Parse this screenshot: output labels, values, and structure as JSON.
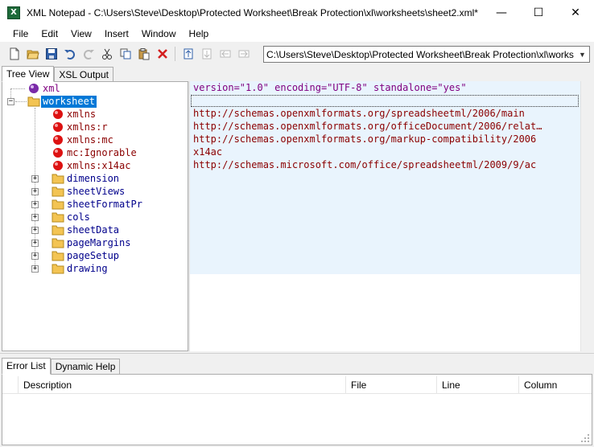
{
  "window": {
    "title": "XML Notepad - C:\\Users\\Steve\\Desktop\\Protected Worksheet\\Break Protection\\xl\\worksheets\\sheet2.xml*",
    "icon_letter": "X",
    "minimize": "—",
    "maximize": "☐",
    "close": "✕"
  },
  "menu": {
    "items": [
      "File",
      "Edit",
      "View",
      "Insert",
      "Window",
      "Help"
    ]
  },
  "toolbar": {
    "path_value": "C:\\Users\\Steve\\Desktop\\Protected Worksheet\\Break Protection\\xl\\works",
    "combo_arrow": "▼"
  },
  "top_tabs": [
    "Tree View",
    "XSL Output"
  ],
  "tree": {
    "rows": [
      {
        "label": "xml",
        "kind": "pi"
      },
      {
        "label": "worksheet",
        "kind": "element",
        "selected": true,
        "expander": "−"
      },
      {
        "label": "xmlns",
        "kind": "attr"
      },
      {
        "label": "xmlns:r",
        "kind": "attr"
      },
      {
        "label": "xmlns:mc",
        "kind": "attr"
      },
      {
        "label": "mc:Ignorable",
        "kind": "attr"
      },
      {
        "label": "xmlns:x14ac",
        "kind": "attr"
      },
      {
        "label": "dimension",
        "kind": "element",
        "expander": "+"
      },
      {
        "label": "sheetViews",
        "kind": "element",
        "expander": "+"
      },
      {
        "label": "sheetFormatPr",
        "kind": "element",
        "expander": "+"
      },
      {
        "label": "cols",
        "kind": "element",
        "expander": "+"
      },
      {
        "label": "sheetData",
        "kind": "element",
        "expander": "+"
      },
      {
        "label": "pageMargins",
        "kind": "element",
        "expander": "+"
      },
      {
        "label": "pageSetup",
        "kind": "element",
        "expander": "+"
      },
      {
        "label": "drawing",
        "kind": "element",
        "expander": "+"
      }
    ]
  },
  "values": {
    "rows": [
      "version=\"1.0\" encoding=\"UTF-8\" standalone=\"yes\"",
      "",
      "http://schemas.openxmlformats.org/spreadsheetml/2006/main",
      "http://schemas.openxmlformats.org/officeDocument/2006/relat…",
      "http://schemas.openxmlformats.org/markup-compatibility/2006",
      "x14ac",
      "http://schemas.microsoft.com/office/spreadsheetml/2009/9/ac"
    ]
  },
  "bottom_tabs": [
    "Error List",
    "Dynamic Help"
  ],
  "error_list": {
    "columns": [
      "Description",
      "File",
      "Line",
      "Column"
    ]
  },
  "colors": {
    "selection": "#0078d7",
    "element_text": "#00008b",
    "attr_text": "#8b0000",
    "pi_text": "#800080",
    "value_bg": "#e9f4fd"
  }
}
